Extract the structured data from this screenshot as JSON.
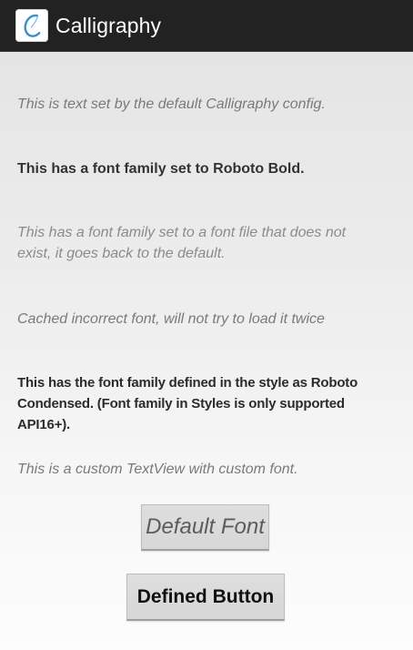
{
  "app": {
    "title": "Calligraphy",
    "icon": "calligraphy-c-icon"
  },
  "colors": {
    "action_bar": "#222222",
    "background_top": "#e3e3e3",
    "background_bottom": "#fdfdfd",
    "button_fill": "#d9d9d9",
    "title_text": "#ffffff"
  },
  "content": {
    "texts": [
      "This is text set by the default Calligraphy config.",
      "This has a font family set to Roboto Bold.",
      "This has a font family set to a font file that does not exist, it goes back to the default.",
      "Cached incorrect font, will not try to load it twice",
      "This has the font family defined in the style as Roboto Condensed. (Font family in Styles is only supported API16+).",
      "This is a custom TextView with custom font."
    ],
    "buttons": {
      "default_font": "Default Font",
      "defined_button": "Defined Button"
    }
  }
}
